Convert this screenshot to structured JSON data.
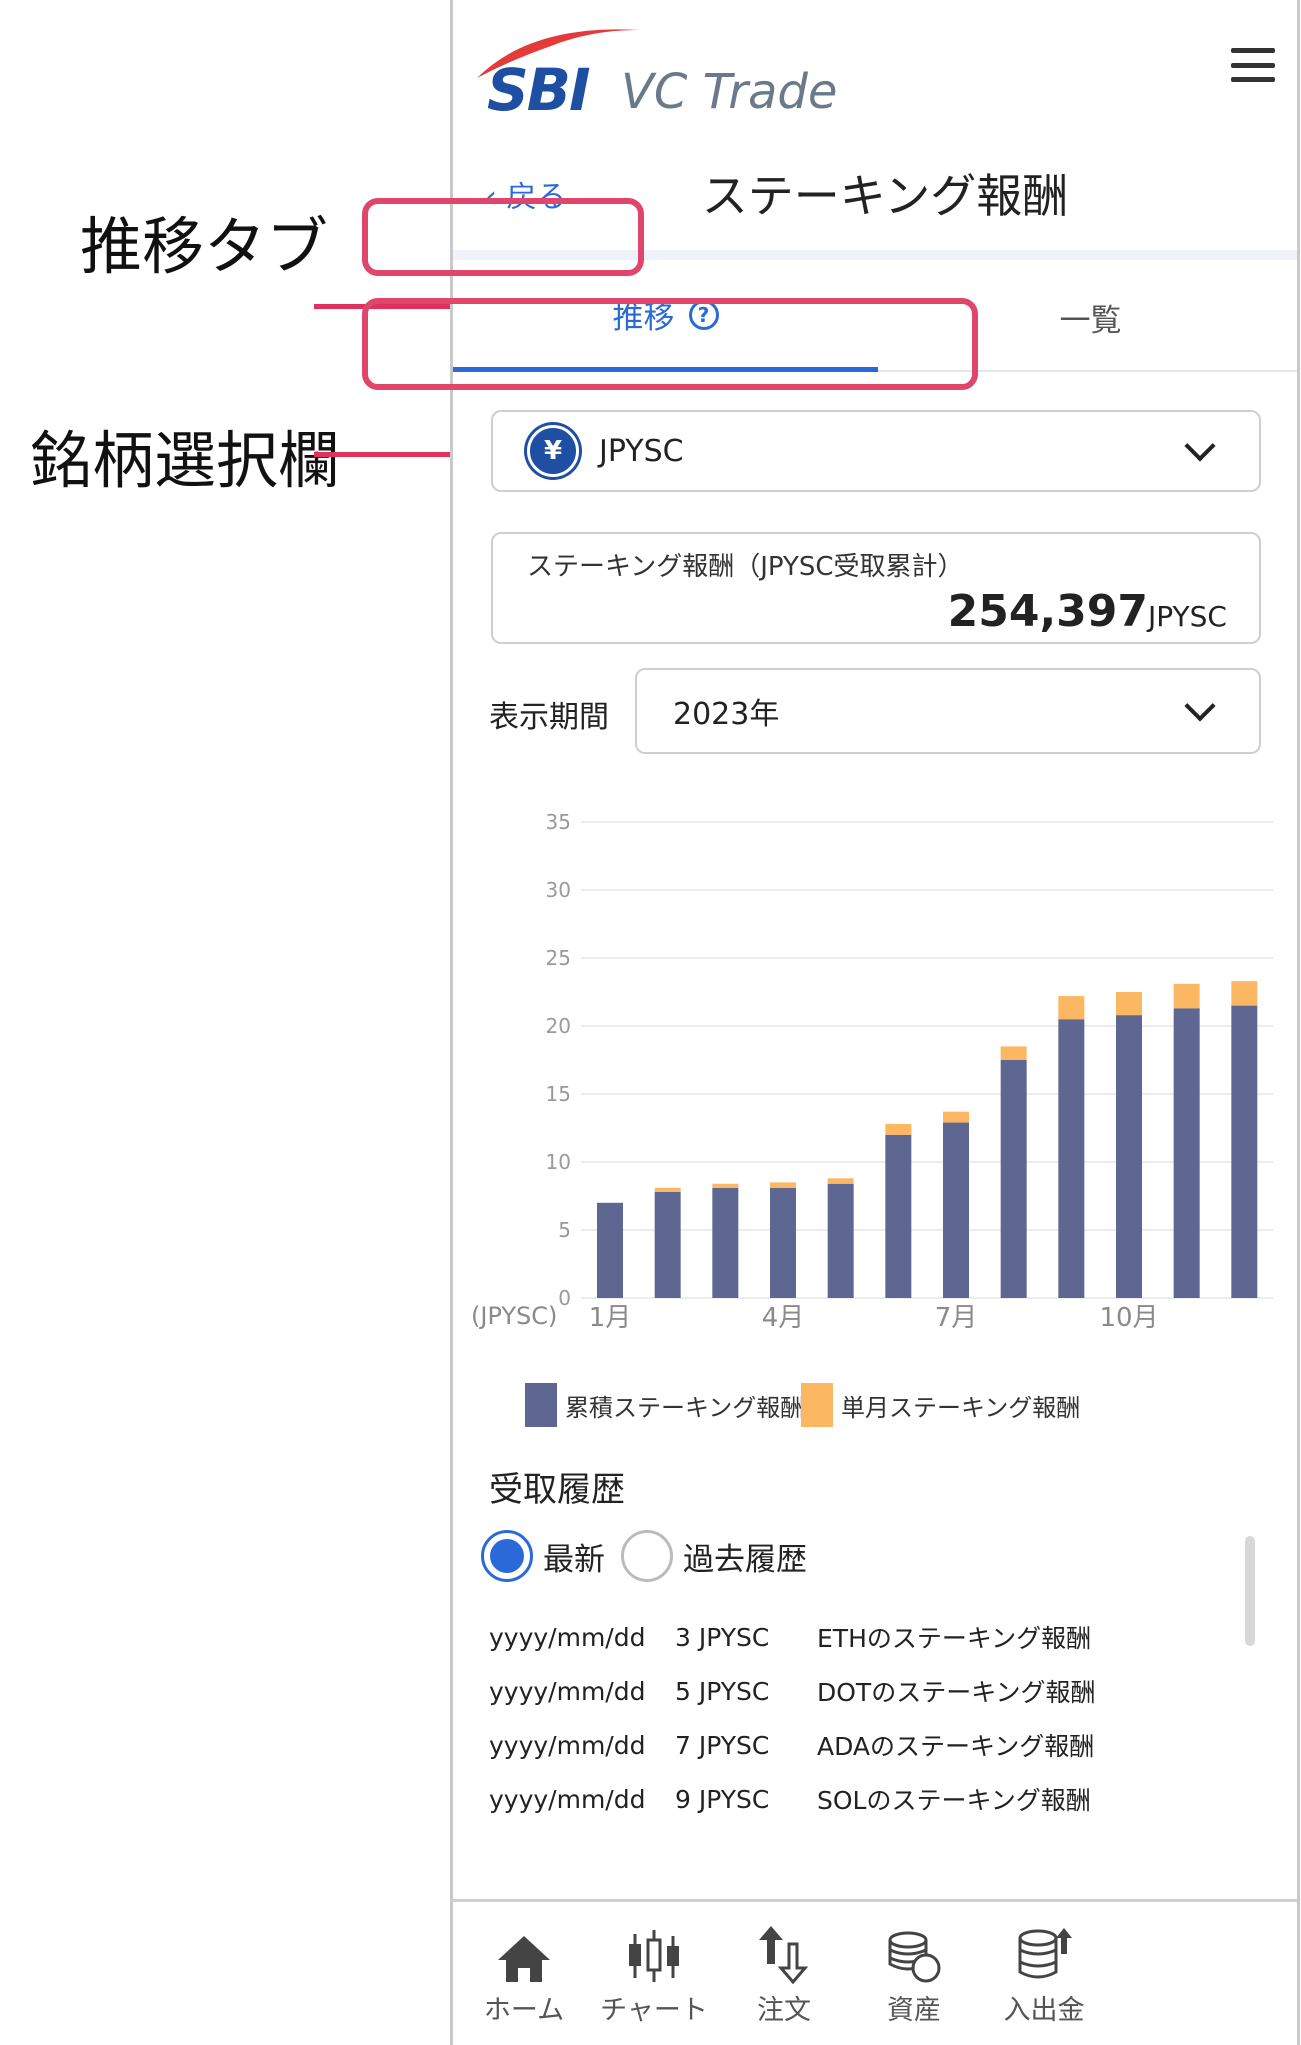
{
  "annotations": {
    "tab_label": "推移タブ",
    "coin_label": "銘柄選択欄"
  },
  "header": {
    "logo_main": "SBI",
    "logo_sub": "VC Trade",
    "back_label": "‹  戻る",
    "title": "ステーキング報酬"
  },
  "tabs": [
    {
      "label": "推移",
      "active": true
    },
    {
      "label": "一覧",
      "active": false
    }
  ],
  "coin_select": {
    "icon_glyph": "¥",
    "value": "JPYSC"
  },
  "total": {
    "label": "ステーキング報酬（JPYSC受取累計）",
    "value": "254,397",
    "unit": "JPYSC"
  },
  "period": {
    "label": "表示期間",
    "value": "2023年"
  },
  "chart_data": {
    "type": "bar",
    "stacked": true,
    "categories": [
      "1月",
      "2月",
      "3月",
      "4月",
      "5月",
      "6月",
      "7月",
      "8月",
      "9月",
      "10月",
      "11月",
      "12月"
    ],
    "x_tick_labels": [
      "1月",
      "",
      "",
      "4月",
      "",
      "",
      "7月",
      "",
      "",
      "10月",
      "",
      ""
    ],
    "series": [
      {
        "name": "累積ステーキング報酬",
        "color": "#5e6791",
        "values": [
          7.0,
          7.8,
          8.1,
          8.1,
          8.4,
          12.0,
          12.9,
          17.5,
          20.5,
          20.8,
          21.3,
          21.5
        ]
      },
      {
        "name": "単月ステーキング報酬",
        "color": "#fbb761",
        "values": [
          0,
          0.3,
          0.3,
          0.4,
          0.4,
          0.8,
          0.8,
          1.0,
          1.7,
          1.7,
          1.8,
          1.8
        ]
      }
    ],
    "ylim": [
      0,
      35
    ],
    "yticks": [
      0,
      5,
      10,
      15,
      20,
      25,
      30,
      35
    ],
    "unit_label": "(JPYSC)",
    "grid": true,
    "legend_position": "bottom"
  },
  "history": {
    "title": "受取履歴",
    "radio_options": [
      {
        "label": "最新",
        "selected": true
      },
      {
        "label": "過去履歴",
        "selected": false
      }
    ],
    "rows": [
      {
        "date": "yyyy/mm/dd",
        "amount": "3 JPYSC",
        "desc": "ETHのステーキング報酬"
      },
      {
        "date": "yyyy/mm/dd",
        "amount": "5 JPYSC",
        "desc": "DOTのステーキング報酬"
      },
      {
        "date": "yyyy/mm/dd",
        "amount": "7 JPYSC",
        "desc": "ADAのステーキング報酬"
      },
      {
        "date": "yyyy/mm/dd",
        "amount": "9 JPYSC",
        "desc": "SOLのステーキング報酬"
      }
    ]
  },
  "bottom_nav": [
    {
      "label": "ホーム",
      "icon": "home-icon"
    },
    {
      "label": "チャート",
      "icon": "candlestick-icon"
    },
    {
      "label": "注文",
      "icon": "order-arrows-icon"
    },
    {
      "label": "資産",
      "icon": "coins-icon"
    },
    {
      "label": "入出金",
      "icon": "deposit-withdraw-icon"
    }
  ]
}
